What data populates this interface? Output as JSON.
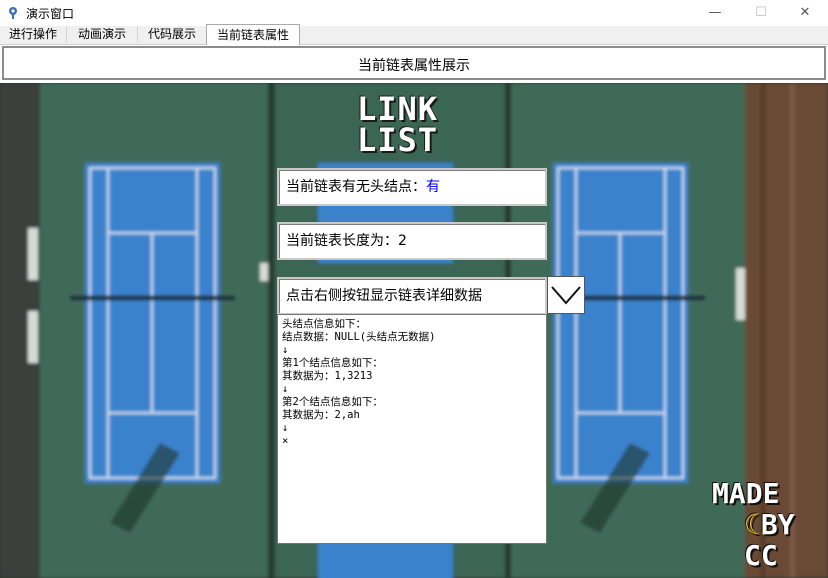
{
  "window": {
    "title": "演示窗口",
    "minimize": "—",
    "maximize": "☐",
    "close": "✕"
  },
  "tabs": [
    {
      "label": "进行操作"
    },
    {
      "label": "动画演示"
    },
    {
      "label": "代码展示"
    },
    {
      "label": "当前链表属性",
      "active": true
    }
  ],
  "header": {
    "title": "当前链表属性展示"
  },
  "logo": {
    "line1": "LINK",
    "line2": "LIST"
  },
  "head_node": {
    "label": "当前链表有无头结点：",
    "value": "有",
    "value_color": "#0000ff"
  },
  "length": {
    "label": "当前链表长度为：2"
  },
  "details_toggle": {
    "label": "点击右侧按钮显示链表详细数据"
  },
  "details": {
    "lines": [
      "头结点信息如下：",
      "结点数据：NULL(头结点无数据)",
      "↓",
      "第1个结点信息如下：",
      "其数据为：1,3213",
      "↓",
      "第2个结点信息如下：",
      "其数据为：2,ah",
      "↓",
      "×"
    ]
  },
  "watermark": {
    "line1": "MADE",
    "line2": "BY",
    "line3": "CC"
  },
  "colors": {
    "court_blue": "#3a82cc",
    "court_green": "#3d6b5a",
    "wood": "#6b4a35"
  }
}
